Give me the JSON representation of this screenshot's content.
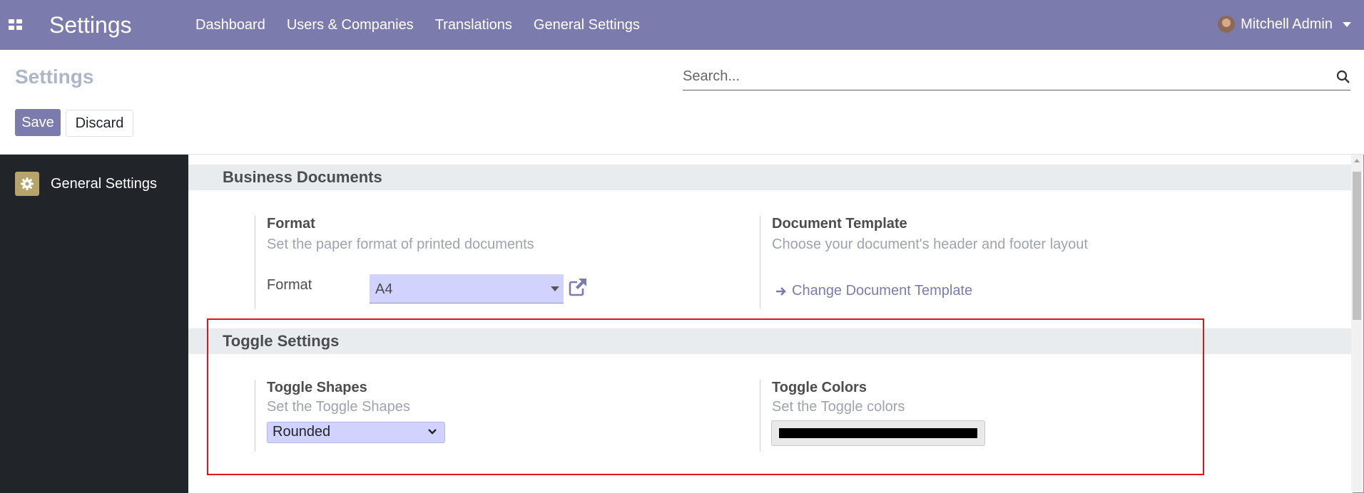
{
  "navbar": {
    "brand": "Settings",
    "menu": [
      "Dashboard",
      "Users & Companies",
      "Translations",
      "General Settings"
    ],
    "user_name": "Mitchell Admin"
  },
  "control_panel": {
    "title": "Settings",
    "search_placeholder": "Search...",
    "save_label": "Save",
    "discard_label": "Discard"
  },
  "sidebar": {
    "items": [
      {
        "label": "General Settings",
        "icon": "gear-icon"
      }
    ]
  },
  "sections": {
    "business_documents": {
      "title": "Business Documents",
      "format": {
        "title": "Format",
        "description": "Set the paper format of printed documents",
        "field_label": "Format",
        "field_value": "A4"
      },
      "document_template": {
        "title": "Document Template",
        "description": "Choose your document's header and footer layout",
        "link_label": "Change Document Template"
      }
    },
    "toggle_settings": {
      "title": "Toggle Settings",
      "toggle_shapes": {
        "title": "Toggle Shapes",
        "description": "Set the Toggle Shapes",
        "value": "Rounded"
      },
      "toggle_colors": {
        "title": "Toggle Colors",
        "description": "Set the Toggle colors",
        "color_value": "#000000"
      }
    }
  },
  "colors": {
    "navbar": "#7c7bad",
    "sidebar": "#212529",
    "accent": "#7c7bad",
    "select_bg": "#d2d2ff",
    "highlight_border": "#e0151b"
  }
}
